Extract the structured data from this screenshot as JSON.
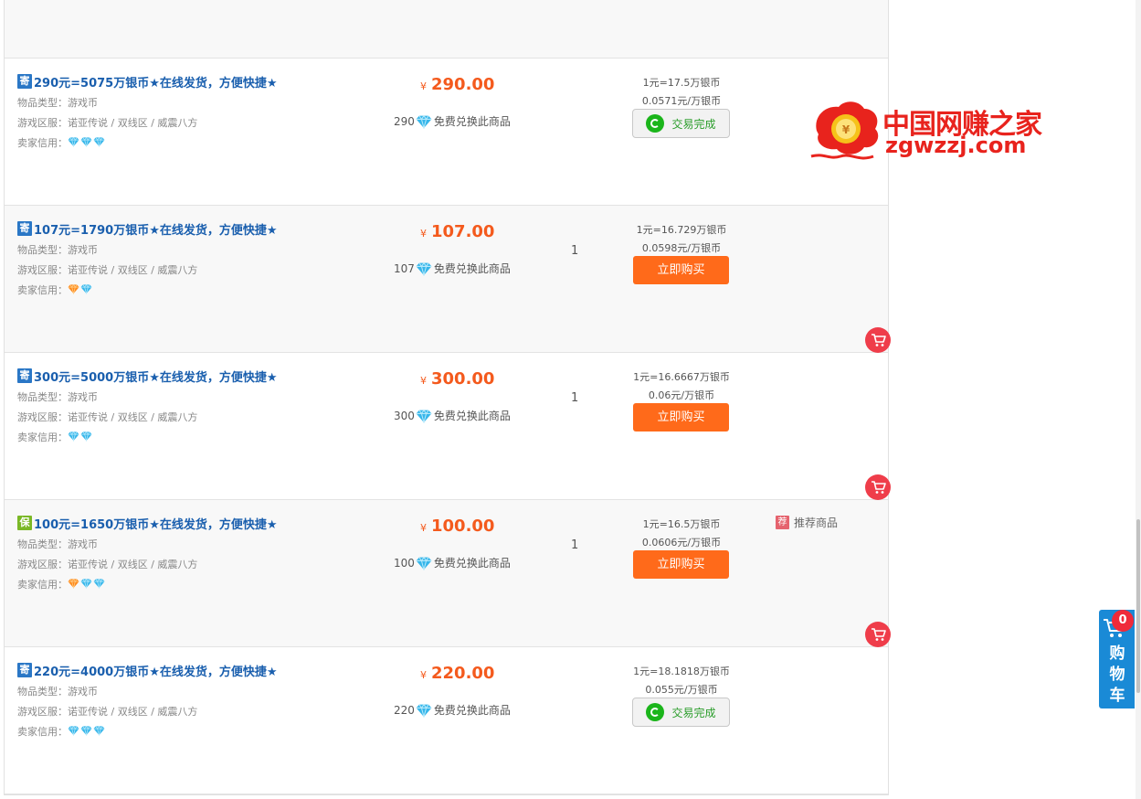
{
  "listings": [
    {
      "badge": "寄",
      "badge_color": "#2a77c6",
      "title": "290元=5075万银币★在线发货，方便快捷★",
      "type_label": "物品类型：",
      "type_value": "游戏币",
      "server_label": "游戏区服：",
      "server_value": "诺亚传说 / 双线区 / 威震八方",
      "credit_label": "卖家信用：",
      "credit_gems": [
        "blue",
        "blue",
        "blue"
      ],
      "currency_symbol": "¥",
      "price": "290.00",
      "points": "290",
      "points_text": "免费兑换此商品",
      "quantity": "",
      "rate1": "1元=17.5万银币",
      "rate2": "0.0571元/万银币",
      "action": "交易完成",
      "action_kind": "done",
      "recommend": "",
      "show_cart_icon": false
    },
    {
      "badge": "寄",
      "badge_color": "#2a77c6",
      "title": "107元=1790万银币★在线发货，方便快捷★",
      "type_label": "物品类型：",
      "type_value": "游戏币",
      "server_label": "游戏区服：",
      "server_value": "诺亚传说 / 双线区 / 威震八方",
      "credit_label": "卖家信用：",
      "credit_gems": [
        "orange",
        "blue"
      ],
      "currency_symbol": "¥",
      "price": "107.00",
      "points": "107",
      "points_text": "免费兑换此商品",
      "quantity": "1",
      "rate1": "1元=16.729万银币",
      "rate2": "0.0598元/万银币",
      "action": "立即购买",
      "action_kind": "buy",
      "recommend": "",
      "show_cart_icon": true
    },
    {
      "badge": "寄",
      "badge_color": "#2a77c6",
      "title": "300元=5000万银币★在线发货，方便快捷★",
      "type_label": "物品类型：",
      "type_value": "游戏币",
      "server_label": "游戏区服：",
      "server_value": "诺亚传说 / 双线区 / 威震八方",
      "credit_label": "卖家信用：",
      "credit_gems": [
        "blue",
        "blue"
      ],
      "currency_symbol": "¥",
      "price": "300.00",
      "points": "300",
      "points_text": "免费兑换此商品",
      "quantity": "1",
      "rate1": "1元=16.6667万银币",
      "rate2": "0.06元/万银币",
      "action": "立即购买",
      "action_kind": "buy",
      "recommend": "",
      "show_cart_icon": true
    },
    {
      "badge": "保",
      "badge_color": "#7ab826",
      "title": "100元=1650万银币★在线发货，方便快捷★",
      "type_label": "物品类型：",
      "type_value": "游戏币",
      "server_label": "游戏区服：",
      "server_value": "诺亚传说 / 双线区 / 威震八方",
      "credit_label": "卖家信用：",
      "credit_gems": [
        "orange",
        "blue",
        "blue"
      ],
      "currency_symbol": "¥",
      "price": "100.00",
      "points": "100",
      "points_text": "免费兑换此商品",
      "quantity": "1",
      "rate1": "1元=16.5万银币",
      "rate2": "0.0606元/万银币",
      "action": "立即购买",
      "action_kind": "buy",
      "recommend": "推荐商品",
      "recommend_tag": "荐",
      "show_cart_icon": true
    },
    {
      "badge": "寄",
      "badge_color": "#2a77c6",
      "title": "220元=4000万银币★在线发货，方便快捷★",
      "type_label": "物品类型：",
      "type_value": "游戏币",
      "server_label": "游戏区服：",
      "server_value": "诺亚传说 / 双线区 / 威震八方",
      "credit_label": "卖家信用：",
      "credit_gems": [
        "blue",
        "blue",
        "blue"
      ],
      "currency_symbol": "¥",
      "price": "220.00",
      "points": "220",
      "points_text": "免费兑换此商品",
      "quantity": "",
      "rate1": "1元=18.1818万银币",
      "rate2": "0.055元/万银币",
      "action": "交易完成",
      "action_kind": "done",
      "recommend": "",
      "show_cart_icon": false
    }
  ],
  "watermark": {
    "cn": "中国网赚之家",
    "en": "zgwzzj.com"
  },
  "side_cart": {
    "count": "0",
    "label": "购物车"
  },
  "colors": {
    "price": "#f45a1d",
    "buy_button": "#ff6a1a",
    "title_link": "#1a5fae",
    "side_cart": "#1a8ad6"
  }
}
